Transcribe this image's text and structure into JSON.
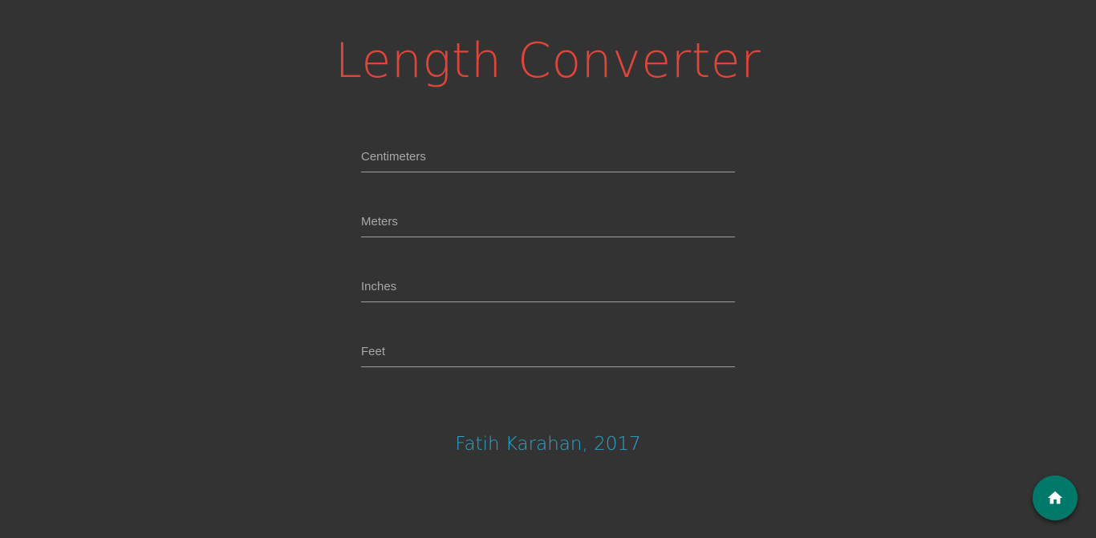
{
  "header": {
    "title": "Length Converter"
  },
  "converter": {
    "fields": [
      {
        "placeholder": "Centimeters",
        "value": ""
      },
      {
        "placeholder": "Meters",
        "value": ""
      },
      {
        "placeholder": "Inches",
        "value": ""
      },
      {
        "placeholder": "Feet",
        "value": ""
      }
    ]
  },
  "footer": {
    "credit": "Fatih Karahan, 2017"
  },
  "fab": {
    "icon": "home-icon"
  },
  "colors": {
    "background": "#333333",
    "title": "#e0453a",
    "credit": "#29a6cf",
    "fab": "#00796b"
  }
}
